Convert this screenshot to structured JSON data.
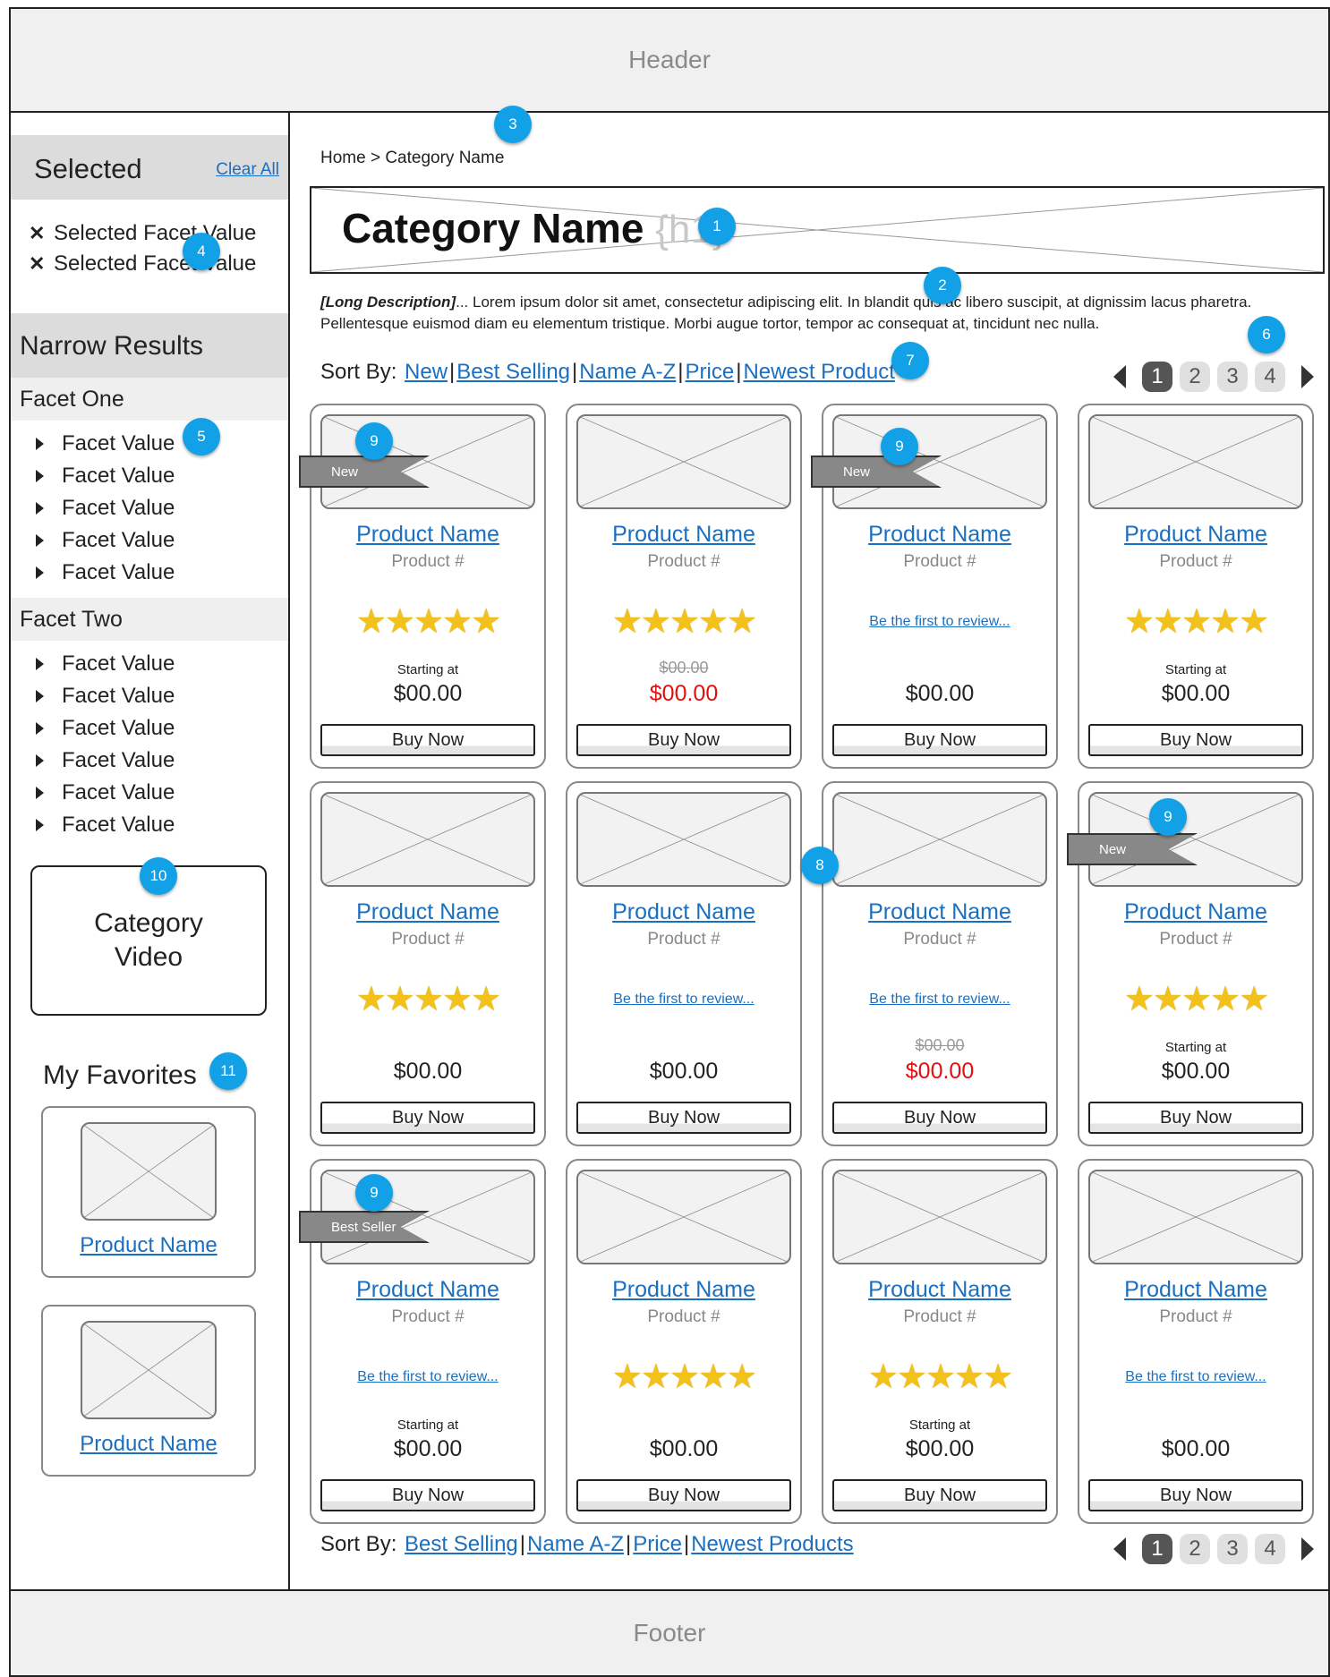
{
  "header": {
    "label": "Header"
  },
  "footer": {
    "label": "Footer"
  },
  "sidebar": {
    "selected_title": "Selected",
    "clear_all": "Clear All",
    "selected_items": [
      "Selected Facet Value",
      "Selected Facet Value"
    ],
    "narrow_title": "Narrow Results",
    "facet_one": {
      "title": "Facet One",
      "items": [
        "Facet Value",
        "Facet Value",
        "Facet Value",
        "Facet Value",
        "Facet Value"
      ]
    },
    "facet_two": {
      "title": "Facet Two",
      "items": [
        "Facet Value",
        "Facet Value",
        "Facet Value",
        "Facet Value",
        "Facet Value",
        "Facet Value"
      ]
    },
    "video": {
      "line1": "Category",
      "line2": "Video"
    },
    "favorites_title": "My Favorites",
    "favorites": [
      {
        "name": "Product Name"
      },
      {
        "name": "Product Name"
      }
    ]
  },
  "main": {
    "breadcrumb": "Home > Category Name",
    "h1": "Category Name",
    "h1_tag": "{h1}",
    "description_lead": "[Long Description]",
    "description_body": "... Lorem ipsum dolor sit amet, consectetur adipiscing elit. In blandit quis ac libero suscipit, at dignissim lacus pharetra. Pellentesque euismod diam eu elementum tristique. Morbi augue tortor, tempor ac consequat at, tincidunt nec nulla.",
    "sort_top": {
      "label": "Sort By:",
      "options": [
        "New",
        "Best Selling",
        "Name A-Z",
        "Price",
        "Newest Product"
      ]
    },
    "sort_bottom": {
      "label": "Sort By:",
      "options": [
        "Best Selling",
        "Name A-Z",
        "Price",
        "Newest Products"
      ]
    },
    "pagination": {
      "pages": [
        "1",
        "2",
        "3",
        "4"
      ],
      "active": "1"
    },
    "buy_label": "Buy Now",
    "products": [
      {
        "name": "Product Name",
        "number": "Product #",
        "rating": "★★★★★",
        "review": "",
        "starting": "Starting at",
        "old_price": "",
        "price": "$00.00",
        "sale": false,
        "ribbon": "New"
      },
      {
        "name": "Product Name",
        "number": "Product #",
        "rating": "★★★★★",
        "review": "",
        "starting": "",
        "old_price": "$00.00",
        "price": "$00.00",
        "sale": true,
        "ribbon": ""
      },
      {
        "name": "Product Name",
        "number": "Product #",
        "rating": "",
        "review": "Be the first to review...",
        "starting": "",
        "old_price": "",
        "price": "$00.00",
        "sale": false,
        "ribbon": "New"
      },
      {
        "name": "Product Name",
        "number": "Product #",
        "rating": "★★★★★",
        "review": "",
        "starting": "Starting at",
        "old_price": "",
        "price": "$00.00",
        "sale": false,
        "ribbon": ""
      },
      {
        "name": "Product Name",
        "number": "Product #",
        "rating": "★★★★★",
        "review": "",
        "starting": "",
        "old_price": "",
        "price": "$00.00",
        "sale": false,
        "ribbon": ""
      },
      {
        "name": "Product Name",
        "number": "Product #",
        "rating": "",
        "review": "Be the first to review...",
        "starting": "",
        "old_price": "",
        "price": "$00.00",
        "sale": false,
        "ribbon": ""
      },
      {
        "name": "Product Name",
        "number": "Product #",
        "rating": "",
        "review": "Be the first to review...",
        "starting": "",
        "old_price": "$00.00",
        "price": "$00.00",
        "sale": true,
        "ribbon": ""
      },
      {
        "name": "Product Name",
        "number": "Product #",
        "rating": "★★★★★",
        "review": "",
        "starting": "Starting at",
        "old_price": "",
        "price": "$00.00",
        "sale": false,
        "ribbon": "New"
      },
      {
        "name": "Product Name",
        "number": "Product #",
        "rating": "",
        "review": "Be the first to review...",
        "starting": "Starting at",
        "old_price": "",
        "price": "$00.00",
        "sale": false,
        "ribbon": "Best Seller"
      },
      {
        "name": "Product Name",
        "number": "Product #",
        "rating": "★★★★★",
        "review": "",
        "starting": "",
        "old_price": "",
        "price": "$00.00",
        "sale": false,
        "ribbon": ""
      },
      {
        "name": "Product Name",
        "number": "Product #",
        "rating": "★★★★★",
        "review": "",
        "starting": "Starting at",
        "old_price": "",
        "price": "$00.00",
        "sale": false,
        "ribbon": ""
      },
      {
        "name": "Product Name",
        "number": "Product #",
        "rating": "",
        "review": "Be the first to review...",
        "starting": "",
        "old_price": "",
        "price": "$00.00",
        "sale": false,
        "ribbon": ""
      }
    ]
  },
  "callouts": [
    "1",
    "2",
    "3",
    "4",
    "5",
    "6",
    "7",
    "8",
    "9",
    "10",
    "11"
  ],
  "colors": {
    "accent": "#12a0e6",
    "link": "#1a6fc0",
    "sale": "#e01010",
    "star": "#f2c21a",
    "panel": "#dcdcdc"
  }
}
